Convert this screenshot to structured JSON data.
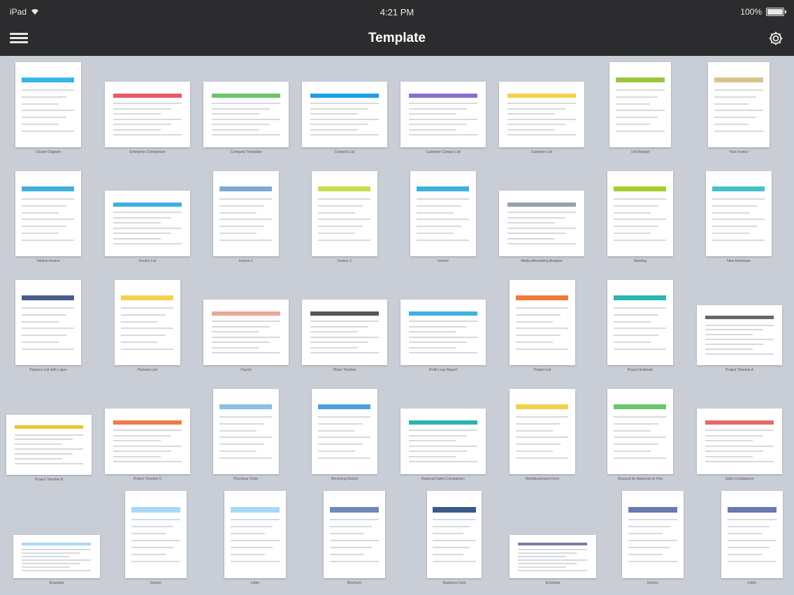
{
  "status_bar": {
    "device": "iPad",
    "time": "4:21 PM",
    "battery": "100%"
  },
  "nav": {
    "title": "Template"
  },
  "templates": [
    {
      "label": "Cluster Diagram",
      "accent": "#34b7e6"
    },
    {
      "label": "Enterprise Comparison",
      "accent": "#e85a6a"
    },
    {
      "label": "Company Timetable",
      "accent": "#6bc46b"
    },
    {
      "label": "Contacts List",
      "accent": "#1e9ee8"
    },
    {
      "label": "Customer Contact List",
      "accent": "#8a6fd1"
    },
    {
      "label": "Customer List",
      "accent": "#f2d24b"
    },
    {
      "label": "Unit Budget",
      "accent": "#9bc53d"
    },
    {
      "label": "Your Invoice",
      "accent": "#d9c38a"
    },
    {
      "label": "Vehicle Invoice",
      "accent": "#3fb0e0"
    },
    {
      "label": "Invoice List",
      "accent": "#3fb0e0"
    },
    {
      "label": "Invoice 1",
      "accent": "#7fa7d6"
    },
    {
      "label": "Invoice 2",
      "accent": "#c6de4b"
    },
    {
      "label": "Invoice",
      "accent": "#3fb0e0"
    },
    {
      "label": "Media Advertising Analysis",
      "accent": "#9aa0a8"
    },
    {
      "label": "Meeting",
      "accent": "#a5cf2a"
    },
    {
      "label": "New Employee",
      "accent": "#45c2c9"
    },
    {
      "label": "Partners List with Logos",
      "accent": "#4a5d8a"
    },
    {
      "label": "Partners List",
      "accent": "#f2d24b"
    },
    {
      "label": "Payroll",
      "accent": "#e8a79a"
    },
    {
      "label": "Photo Timeline",
      "accent": "#555555"
    },
    {
      "label": "Profit Loss Report",
      "accent": "#3fb0e0"
    },
    {
      "label": "Project List",
      "accent": "#f07a3a"
    },
    {
      "label": "Project Estimate",
      "accent": "#2bb3b0"
    },
    {
      "label": "Project Timeline A",
      "accent": "#666666"
    },
    {
      "label": "Project Timeline B",
      "accent": "#f2c230"
    },
    {
      "label": "Project Timeline C",
      "accent": "#f07a4a"
    },
    {
      "label": "Purchase Order",
      "accent": "#8ac0e0"
    },
    {
      "label": "Receiving Report",
      "accent": "#4aa0e0"
    },
    {
      "label": "Regional Sales Comparison",
      "accent": "#2bb3b0"
    },
    {
      "label": "Reimbursement Form",
      "accent": "#f2d24b"
    },
    {
      "label": "Request for Approval on Hire",
      "accent": "#6bc46b"
    },
    {
      "label": "Sales Comparison",
      "accent": "#e86a6a"
    },
    {
      "label": "Envelope",
      "accent": "#a8d8f5"
    },
    {
      "label": "Invoice",
      "accent": "#a8d8f5"
    },
    {
      "label": "Letter",
      "accent": "#a8d8f5"
    },
    {
      "label": "Brochure",
      "accent": "#6a8ab8"
    },
    {
      "label": "Business Card",
      "accent": "#3a5a8a"
    },
    {
      "label": "Envelope",
      "accent": "#7a7aa8"
    },
    {
      "label": "Invoice",
      "accent": "#6a7ab0"
    },
    {
      "label": "Letter",
      "accent": "#6a7ab0"
    }
  ]
}
